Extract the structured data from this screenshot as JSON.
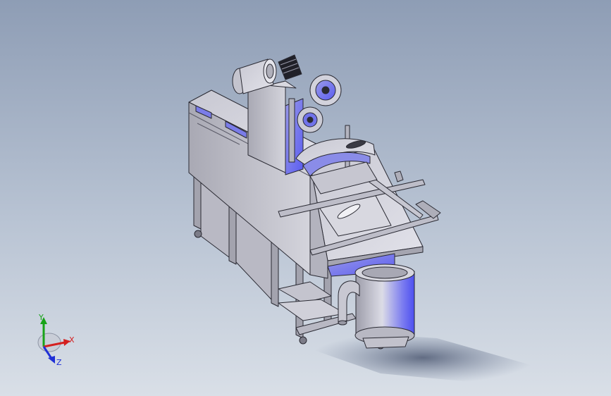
{
  "viewport": {
    "background_top": "#8e9db5",
    "background_bottom": "#d9dfe7",
    "model_shading": "#c8c8d2",
    "model_shadow": "#6d7b98",
    "accent_blue": "#5a5cf0",
    "edge_color": "#2a2a33"
  },
  "triad": {
    "x_label": "X",
    "y_label": "Y",
    "z_label": "Z",
    "x_color": "#d42020",
    "y_color": "#18a318",
    "z_color": "#2030d6"
  }
}
